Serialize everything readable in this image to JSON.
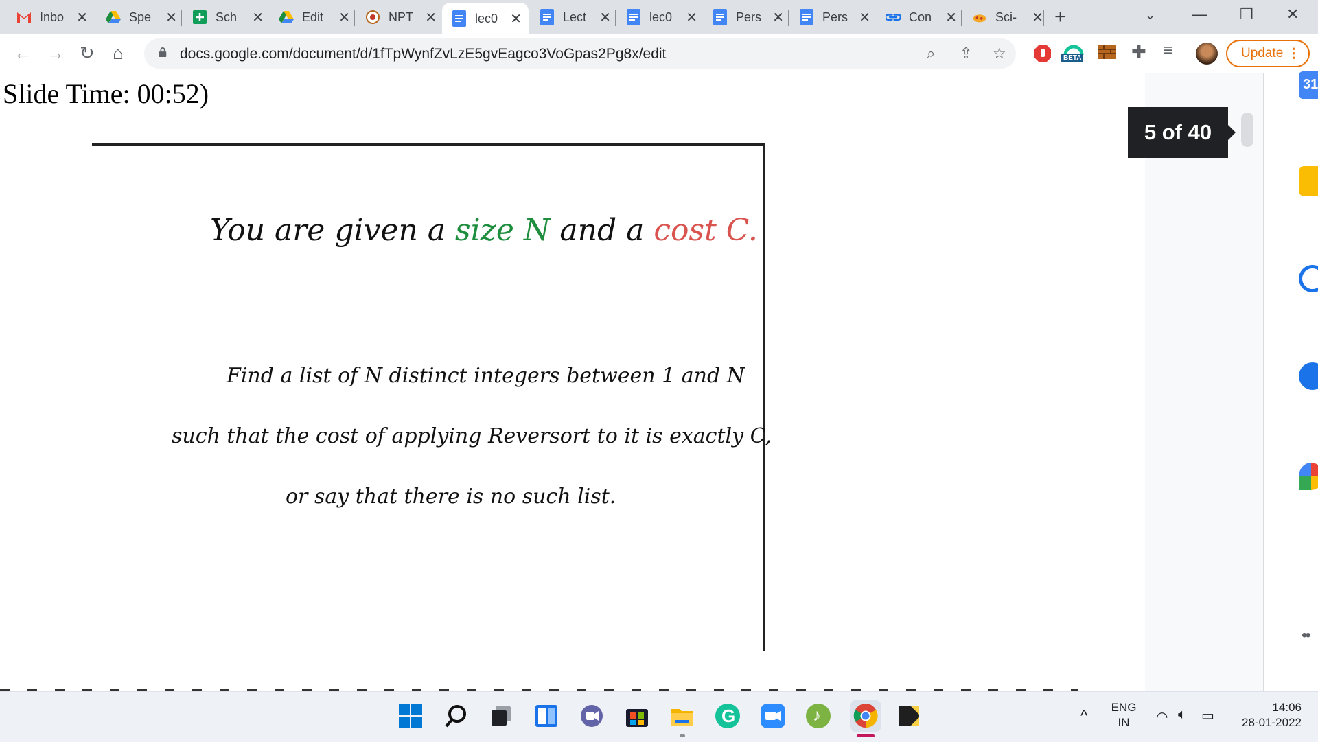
{
  "browser": {
    "tabs": [
      {
        "label": "Inbo",
        "icon": "gmail-icon",
        "active": false
      },
      {
        "label": "Spe",
        "icon": "google-drive-icon",
        "active": false
      },
      {
        "label": "Sch",
        "icon": "google-sheets-icon",
        "active": false
      },
      {
        "label": "Edit",
        "icon": "google-drive-icon",
        "active": false
      },
      {
        "label": "NPT",
        "icon": "nptel-icon",
        "active": false
      },
      {
        "label": "lec0",
        "icon": "google-docs-icon",
        "active": true
      },
      {
        "label": "Lect",
        "icon": "google-docs-icon",
        "active": false
      },
      {
        "label": "lec0",
        "icon": "google-docs-icon",
        "active": false
      },
      {
        "label": "Pers",
        "icon": "google-docs-icon",
        "active": false
      },
      {
        "label": "Pers",
        "icon": "google-docs-icon",
        "active": false
      },
      {
        "label": "Con",
        "icon": "link-icon",
        "active": false
      },
      {
        "label": "Sci-",
        "icon": "scihub-icon",
        "active": false
      }
    ],
    "url": "docs.google.com/document/d/1fTpWynfZvLzE5gvEagco3VoGpas2Pg8x/edit",
    "update_label": "Update",
    "beta_badge": "BETA"
  },
  "document": {
    "slide_time_text": "Slide Time: 00:52)",
    "slide": {
      "line1_part1": "You are given a",
      "line1_green": "size N",
      "line1_part2": "and a",
      "line1_red": "cost C.",
      "line2": "Find a list of N distinct integers between 1 and N",
      "line3": "such that the cost of applying Reversort to it is exactly C,",
      "line4": "or say that there is no such list."
    },
    "page_counter": "5 of 40"
  },
  "taskbar": {
    "language": "ENG",
    "region": "IN",
    "time": "14:06",
    "date": "28-01-2022"
  },
  "colors": {
    "accent_orange": "#e8710a",
    "green_text": "#1e8e3e",
    "red_text": "#d9534f",
    "docs_blue": "#4285f4"
  }
}
